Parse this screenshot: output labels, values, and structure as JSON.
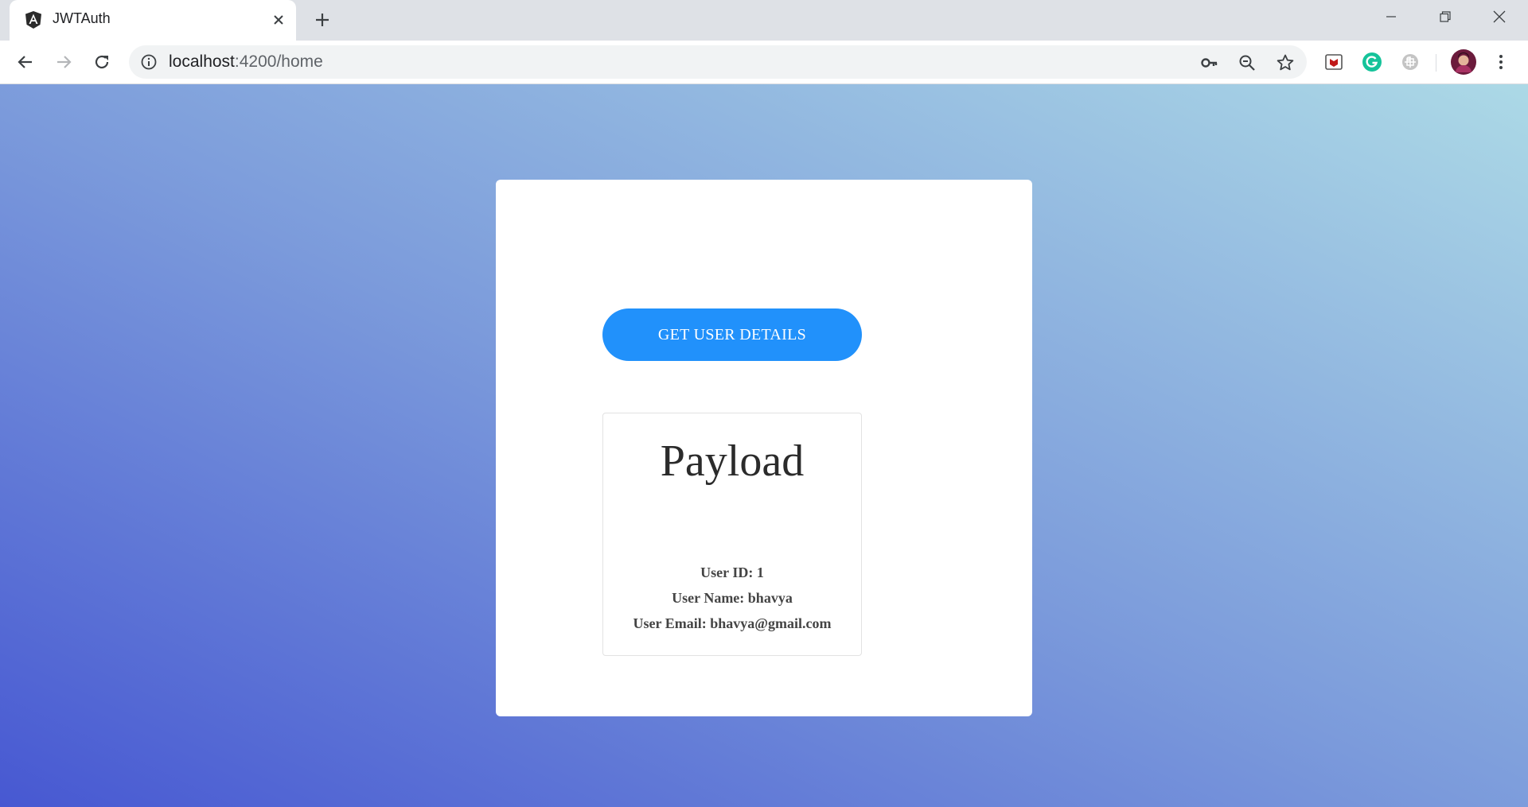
{
  "browser": {
    "tab": {
      "title": "JWTAuth",
      "favicon": "angular-icon"
    },
    "address_bar": {
      "host": "localhost",
      "rest": ":4200/home"
    },
    "toolbar_icons": [
      "back-icon",
      "forward-icon",
      "reload-icon",
      "info-icon",
      "key-icon",
      "zoom-out-icon",
      "star-icon"
    ],
    "extensions": [
      "mcafee-extension-icon",
      "grammarly-extension-icon",
      "extension-icon"
    ],
    "window_controls": [
      "minimize-icon",
      "restore-icon",
      "close-icon"
    ]
  },
  "page": {
    "get_button_label": "GET USER DETAILS",
    "payload": {
      "title": "Payload",
      "fields": [
        {
          "label": "User ID:",
          "value": "1"
        },
        {
          "label": "User Name:",
          "value": "bhavya"
        },
        {
          "label": "User Email:",
          "value": "bhavya@gmail.com"
        }
      ]
    }
  },
  "colors": {
    "button": "#2191fb",
    "gradient_start": "#4758d2",
    "gradient_end": "#acd9e6"
  }
}
